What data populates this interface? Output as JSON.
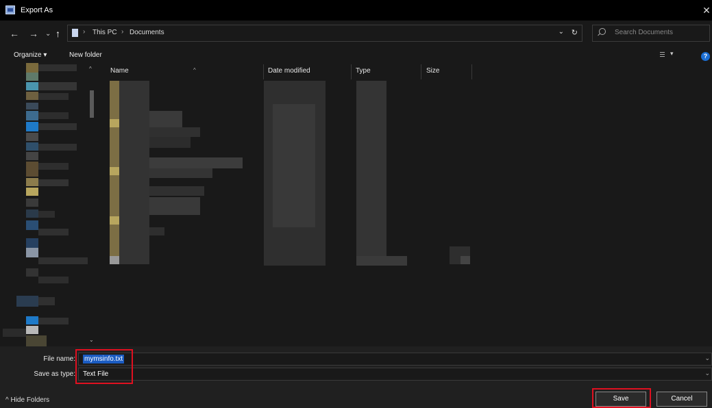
{
  "window": {
    "title": "Export As",
    "close_glyph": "✕"
  },
  "nav": {
    "back": "←",
    "forward": "→",
    "recent": "⌄",
    "up": "↑"
  },
  "address": {
    "crumbs": [
      "This PC",
      "Documents"
    ],
    "separator": "›",
    "dropdown": "⌄",
    "refresh": "↻"
  },
  "search": {
    "placeholder": "Search Documents"
  },
  "toolbar": {
    "organize": "Organize ▾",
    "new_folder": "New folder",
    "view_dropdown": "▾",
    "help": "?"
  },
  "columns": {
    "name": "Name",
    "date_modified": "Date modified",
    "type": "Type",
    "size": "Size",
    "sort_caret": "^"
  },
  "scroll": {
    "up": "^",
    "down": "⌄"
  },
  "form": {
    "file_name_label": "File name:",
    "file_name_value": "mymsinfo.txt",
    "save_type_label": "Save as type:",
    "save_type_value": "Text File",
    "dropdown_glyph": "⌄"
  },
  "footer": {
    "hide_folders": "^  Hide Folders",
    "save": "Save",
    "cancel": "Cancel"
  },
  "colors": {
    "accent": "#1b5cc2",
    "highlight_box": "#e01020",
    "folder": "#b8a65e",
    "background": "#191919"
  }
}
